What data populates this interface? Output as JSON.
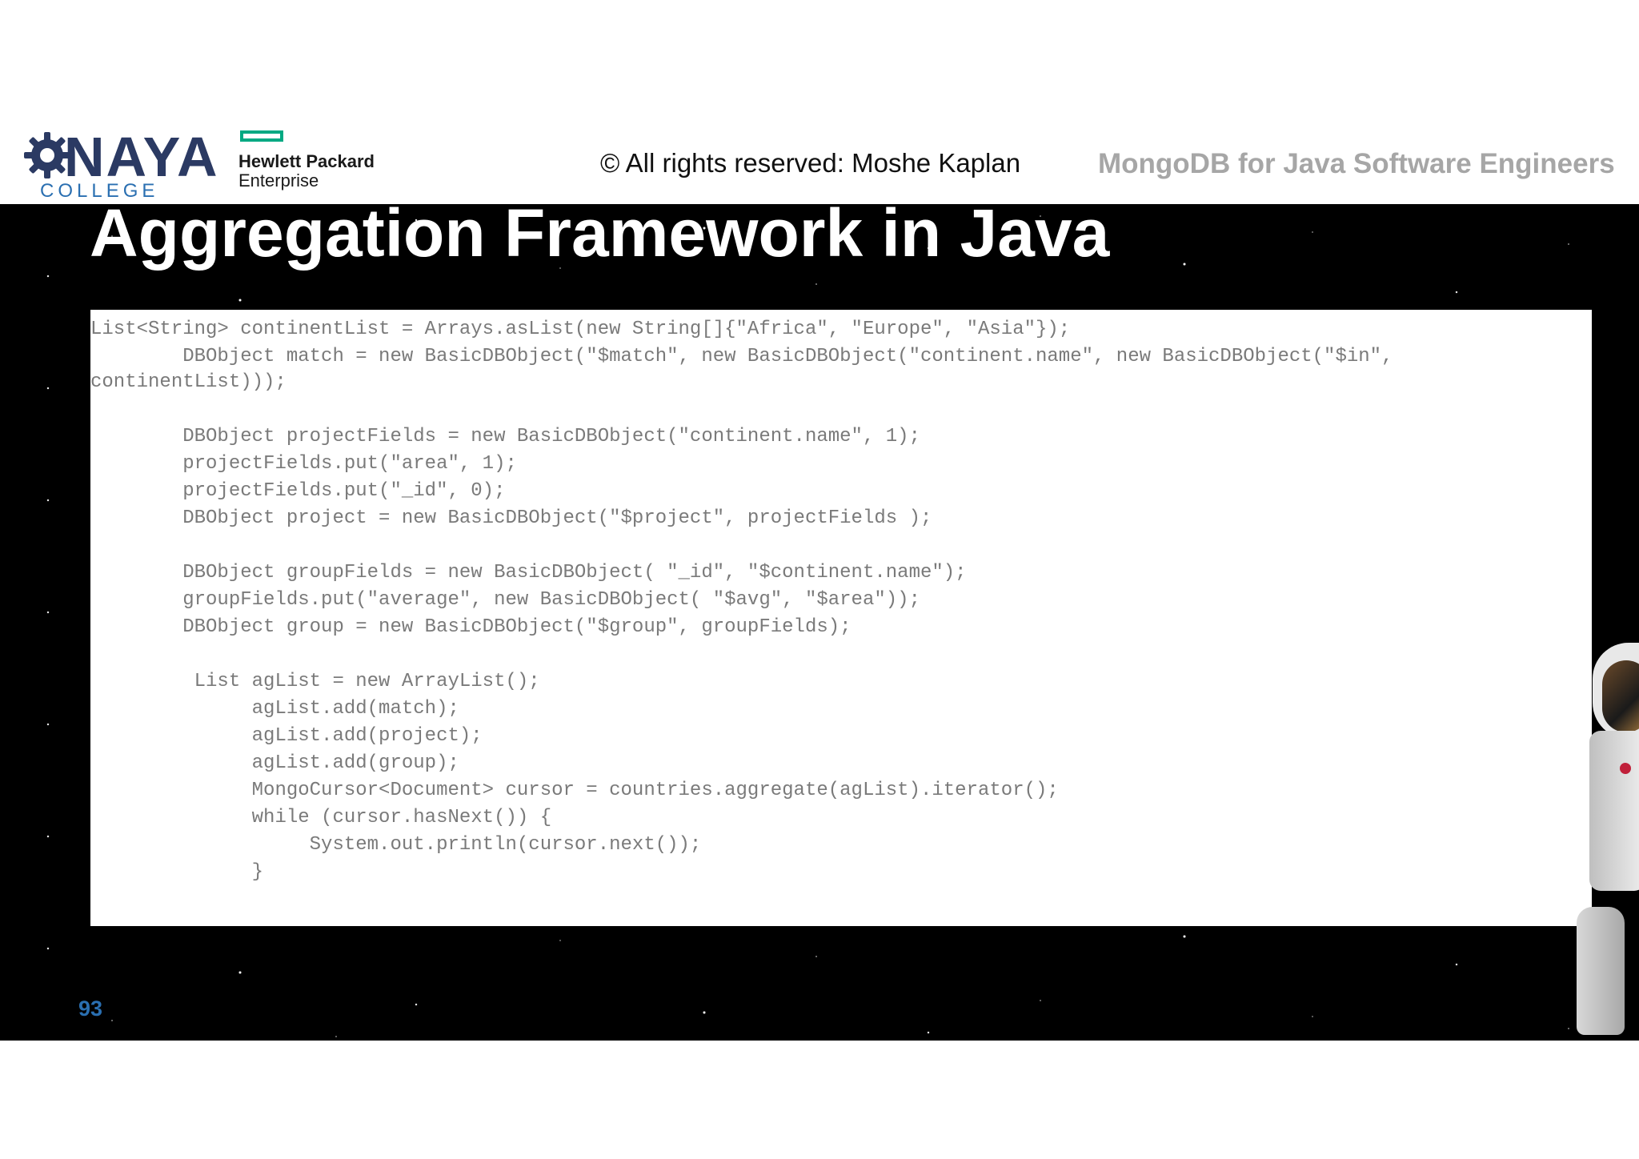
{
  "header": {
    "naya_logo": {
      "icon": "gear-icon",
      "brand": "NAYA",
      "subtitle": "COLLEGE",
      "brand_color": "#2b3a63",
      "subtitle_color": "#2a6fb1"
    },
    "hpe_logo": {
      "line1": "Hewlett Packard",
      "line2": "Enterprise",
      "accent_color": "#01a982"
    },
    "copyright": "© All rights reserved: Moshe Kaplan",
    "course_title": "MongoDB for Java Software Engineers"
  },
  "slide": {
    "title": "Aggregation Framework in Java",
    "background_color": "#000000",
    "code_lines": [
      "List<String> continentList = Arrays.asList(new String[]{\"Africa\", \"Europe\", \"Asia\"});",
      "        DBObject match = new BasicDBObject(\"$match\", new BasicDBObject(\"continent.name\", new BasicDBObject(\"$in\",",
      "continentList)));",
      "",
      "        DBObject projectFields = new BasicDBObject(\"continent.name\", 1);",
      "        projectFields.put(\"area\", 1);",
      "        projectFields.put(\"_id\", 0);",
      "        DBObject project = new BasicDBObject(\"$project\", projectFields );",
      "",
      "        DBObject groupFields = new BasicDBObject( \"_id\", \"$continent.name\");",
      "        groupFields.put(\"average\", new BasicDBObject( \"$avg\", \"$area\"));",
      "        DBObject group = new BasicDBObject(\"$group\", groupFields);",
      "",
      "         List agList = new ArrayList();",
      "              agList.add(match);",
      "              agList.add(project);",
      "              agList.add(group);",
      "              MongoCursor<Document> cursor = countries.aggregate(agList).iterator();",
      "              while (cursor.hasNext()) {",
      "                   System.out.println(cursor.next());",
      "              }"
    ],
    "page_number": "93",
    "decoration": "astronaut-image"
  }
}
